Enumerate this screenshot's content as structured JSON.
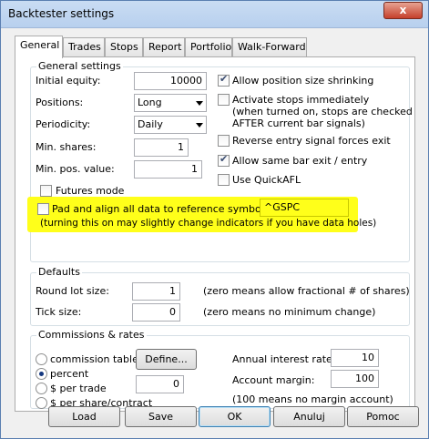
{
  "window": {
    "title": "Backtester settings",
    "close_glyph": "x"
  },
  "tabs": [
    "General",
    "Trades",
    "Stops",
    "Report",
    "Portfolio",
    "Walk-Forward"
  ],
  "general_settings": {
    "title": "General settings",
    "initial_equity_label": "Initial equity:",
    "initial_equity_value": "10000",
    "positions_label": "Positions:",
    "positions_value": "Long",
    "periodicity_label": "Periodicity:",
    "periodicity_value": "Daily",
    "min_shares_label": "Min. shares:",
    "min_shares_value": "1",
    "min_pos_value_label": "Min. pos. value:",
    "min_pos_value_value": "1",
    "futures_mode_label": "Futures mode",
    "allow_shrink_label": "Allow position size shrinking",
    "activate_stops_label": "Activate stops immediately",
    "activate_stops_note1": "(when turned on, stops are checked",
    "activate_stops_note2": "AFTER current bar signals)",
    "reverse_entry_label": "Reverse entry signal forces exit",
    "same_bar_label": "Allow same bar exit / entry",
    "use_quickafl_label": "Use QuickAFL",
    "pad_align_label": "Pad and align all data to reference symbol:",
    "reference_symbol": "^GSPC",
    "pad_note": "(turning this on may slightly change indicators if you have data holes)",
    "checks": {
      "allow_shrink": true,
      "activate_stops": false,
      "reverse_entry": false,
      "same_bar": true,
      "use_quickafl": false,
      "futures_mode": false,
      "pad_align": false
    }
  },
  "defaults": {
    "title": "Defaults",
    "round_lot_label": "Round lot size:",
    "round_lot_value": "1",
    "round_lot_note": "(zero means allow fractional # of shares)",
    "tick_size_label": "Tick size:",
    "tick_size_value": "0",
    "tick_size_note": "(zero means no minimum change)"
  },
  "commissions": {
    "title": "Commissions & rates",
    "options": [
      "commission table",
      "percent",
      "$ per trade",
      "$ per share/contract"
    ],
    "selected": "percent",
    "define_label": "Define...",
    "commission_value": "0",
    "annual_rate_label": "Annual interest rate:",
    "annual_rate_value": "10",
    "account_margin_label": "Account margin:",
    "account_margin_value": "100",
    "margin_note": "(100 means no margin account)"
  },
  "buttons": {
    "load": "Load",
    "save": "Save",
    "ok": "OK",
    "cancel": "Anuluj",
    "help": "Pomoc"
  },
  "colors": {
    "highlight": "#ffff1a",
    "title_bar": "#c9dcf3",
    "close_button": "#c5402b"
  }
}
